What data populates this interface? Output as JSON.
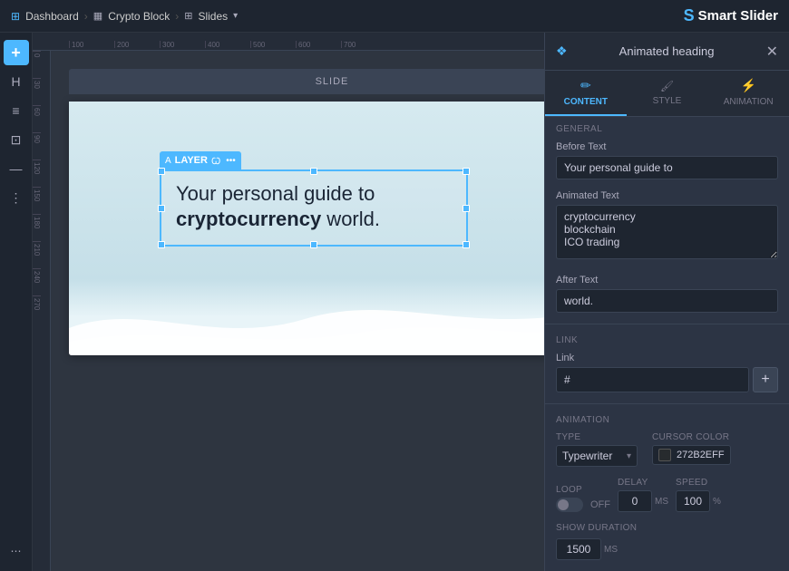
{
  "nav": {
    "dashboard_label": "Dashboard",
    "crypto_block_label": "Crypto Block",
    "slides_label": "Slides",
    "brand_name": "Smart Slider"
  },
  "slide_bar": {
    "label": "SLIDE",
    "dots": "•••"
  },
  "layer": {
    "label": "LAYER",
    "dots": "•••"
  },
  "slide_text": {
    "line1": "Your personal guide to",
    "line2_bold": "cryptocurrency",
    "line2_rest": " world."
  },
  "panel": {
    "title": "Animated heading",
    "tabs": [
      {
        "label": "CONTENT",
        "icon": "✏️"
      },
      {
        "label": "STYLE",
        "icon": "🎨"
      },
      {
        "label": "ANIMATION",
        "icon": "⚡"
      }
    ],
    "sections": {
      "general": "GENERAL",
      "link": "LINK",
      "animation": "ANIMATION"
    },
    "fields": {
      "before_text_label": "Before Text",
      "before_text_value": "Your personal guide to",
      "animated_text_label": "Animated Text",
      "animated_text_value": "cryptocurrency\nblockchain\nICO trading",
      "after_text_label": "After Text",
      "after_text_value": "world.",
      "link_label": "Link",
      "link_value": "#",
      "link_add": "+"
    },
    "animation": {
      "type_label": "Type",
      "type_value": "Typewriter",
      "cursor_color_label": "Cursor Color",
      "cursor_color_value": "272B2EFF",
      "cursor_color_hex": "#272b2e",
      "loop_label": "Loop",
      "loop_state": "OFF",
      "delay_label": "Delay",
      "delay_value": "0",
      "delay_unit": "MS",
      "speed_label": "Speed",
      "speed_value": "100",
      "speed_unit": "%",
      "show_duration_label": "Show Duration",
      "show_duration_value": "1500",
      "show_duration_unit": "MS"
    }
  }
}
